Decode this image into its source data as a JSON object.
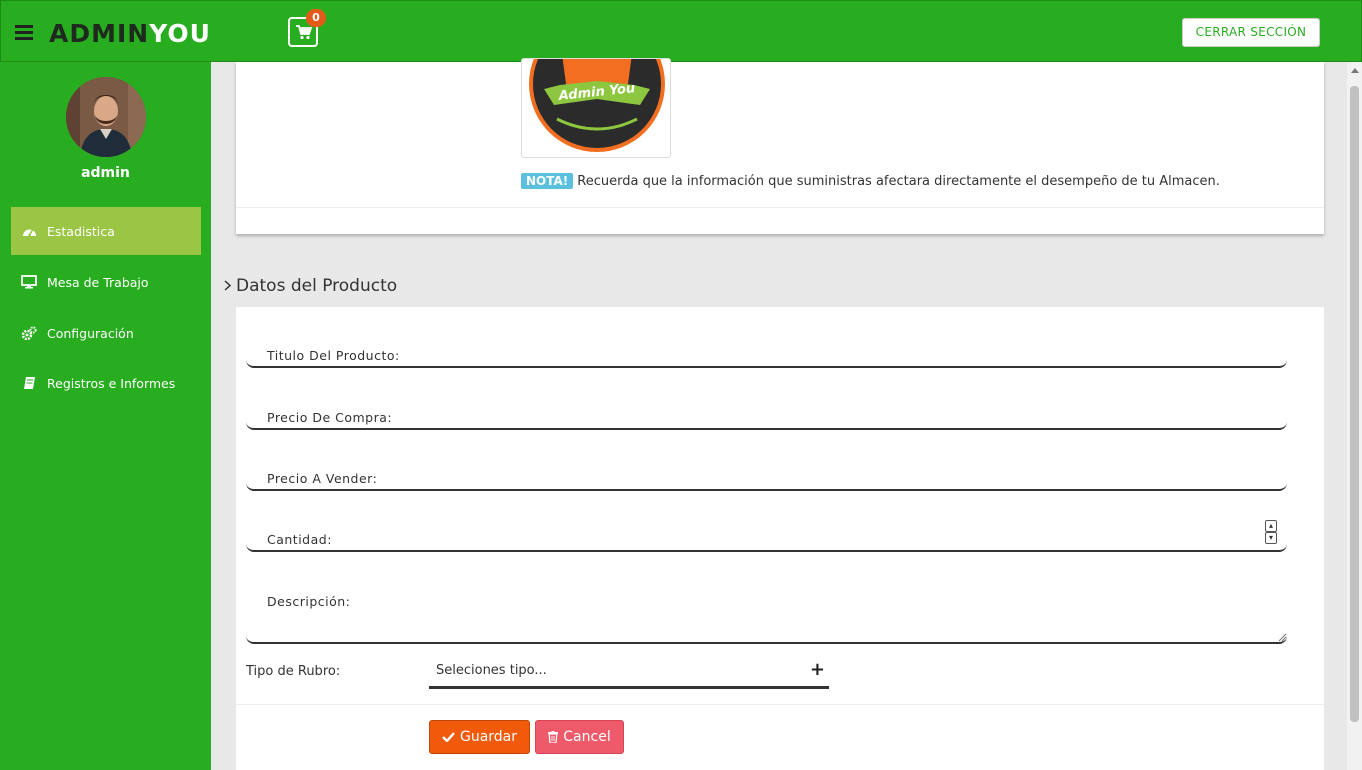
{
  "header": {
    "brand_part1": "ADMIN",
    "brand_part2": "YOU",
    "cart_count": "0",
    "logout_label": "CERRAR SECCIÓN",
    "colors": {
      "primary": "#29ad20",
      "badge": "#e5591b"
    }
  },
  "sidebar": {
    "username": "admin",
    "items": [
      {
        "label": "Estadistica",
        "icon": "dashboard-icon",
        "active": true
      },
      {
        "label": "Mesa de Trabajo",
        "icon": "monitor-icon",
        "active": false
      },
      {
        "label": "Configuración",
        "icon": "gears-icon",
        "active": false
      },
      {
        "label": "Registros e Informes",
        "icon": "book-icon",
        "active": false
      }
    ],
    "active_color": "#9bc544"
  },
  "top_card": {
    "logo_text": "Admin You",
    "note_tag": "NOTA!",
    "note_text": "Recuerda que la información que suministras afectara directamente el desempeño de tu Almacen."
  },
  "product_section": {
    "title": "Datos del Producto",
    "fields": {
      "title_label": "Titulo Del Producto:",
      "purchase_price_label": "Precio De Compra:",
      "sale_price_label": "Precio A Vender:",
      "quantity_label": "Cantidad:",
      "description_label": "Descripción:"
    },
    "rubro_label": "Tipo de Rubro:",
    "rubro_select_value": "Seleciones tipo...",
    "save_label": "Guardar",
    "cancel_label": "Cancel",
    "colors": {
      "save": "#f15a0a",
      "cancel": "#ee5a6a"
    }
  }
}
